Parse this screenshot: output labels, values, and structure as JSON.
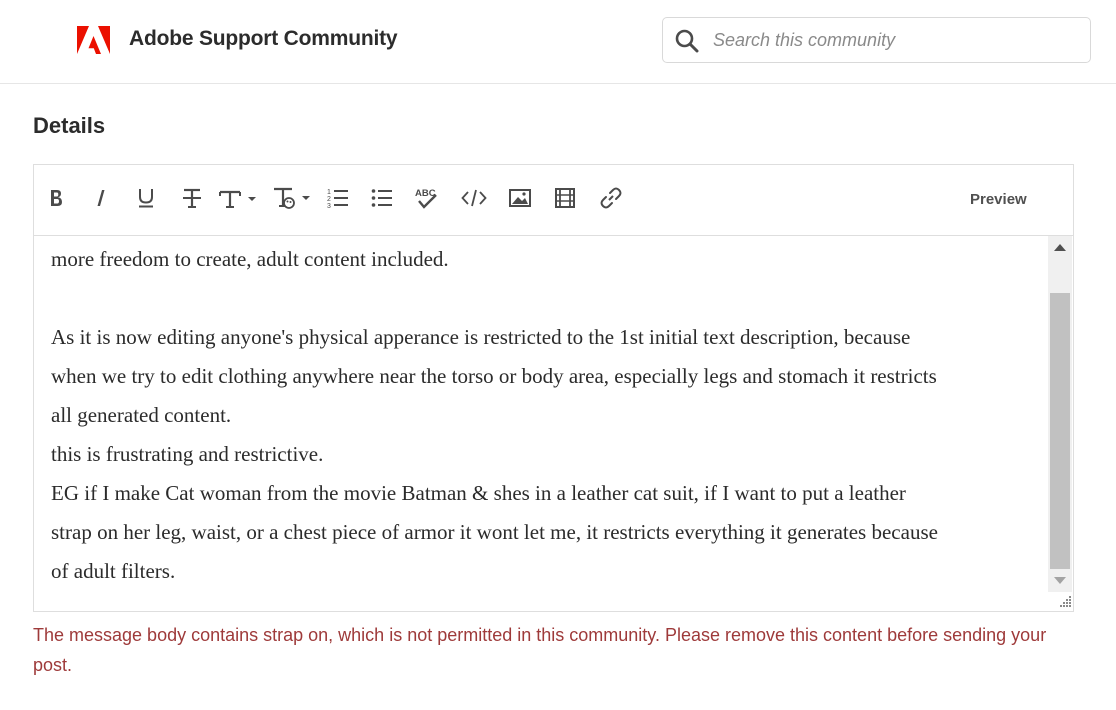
{
  "header": {
    "site_title": "Adobe Support Community",
    "search_placeholder": "Search this community",
    "logo_color": "#eb1000"
  },
  "details": {
    "label": "Details"
  },
  "toolbar": {
    "buttons": [
      {
        "name": "bold-button",
        "icon": "bold-icon",
        "glyph": "B"
      },
      {
        "name": "italic-button",
        "icon": "italic-icon",
        "glyph": "I"
      },
      {
        "name": "underline-button",
        "icon": "underline-icon",
        "glyph": "U"
      },
      {
        "name": "strikethrough-button",
        "icon": "strikethrough-icon"
      },
      {
        "name": "font-size-button",
        "icon": "font-size-icon"
      },
      {
        "name": "text-style-button",
        "icon": "text-style-icon"
      },
      {
        "name": "numbered-list-button",
        "icon": "numbered-list-icon"
      },
      {
        "name": "bulleted-list-button",
        "icon": "bulleted-list-icon"
      },
      {
        "name": "spellcheck-button",
        "icon": "spellcheck-icon"
      },
      {
        "name": "code-button",
        "icon": "code-icon"
      },
      {
        "name": "insert-image-button",
        "icon": "image-icon"
      },
      {
        "name": "insert-video-button",
        "icon": "video-icon"
      },
      {
        "name": "insert-link-button",
        "icon": "link-icon"
      }
    ],
    "preview_label": "Preview"
  },
  "editor": {
    "lines": [
      "more freedom to create, adult content included.",
      "",
      "As it is now editing anyone's physical apperance is restricted to the 1st initial text description, because",
      "when we try to edit clothing anywhere near the torso or body area, especially legs and stomach it restricts",
      "all generated content.",
      "this is frustrating and restrictive.",
      "EG if I make Cat woman from the movie Batman & shes in a leather cat suit, if I want to put a leather",
      "strap on her leg, waist, or a chest piece of armor it wont let me, it restricts everything it generates because",
      "of adult filters."
    ]
  },
  "error": {
    "message": "The message body contains strap on, which is not permitted in this community. Please remove this content before sending your post.",
    "color": "#9e3a3a"
  }
}
